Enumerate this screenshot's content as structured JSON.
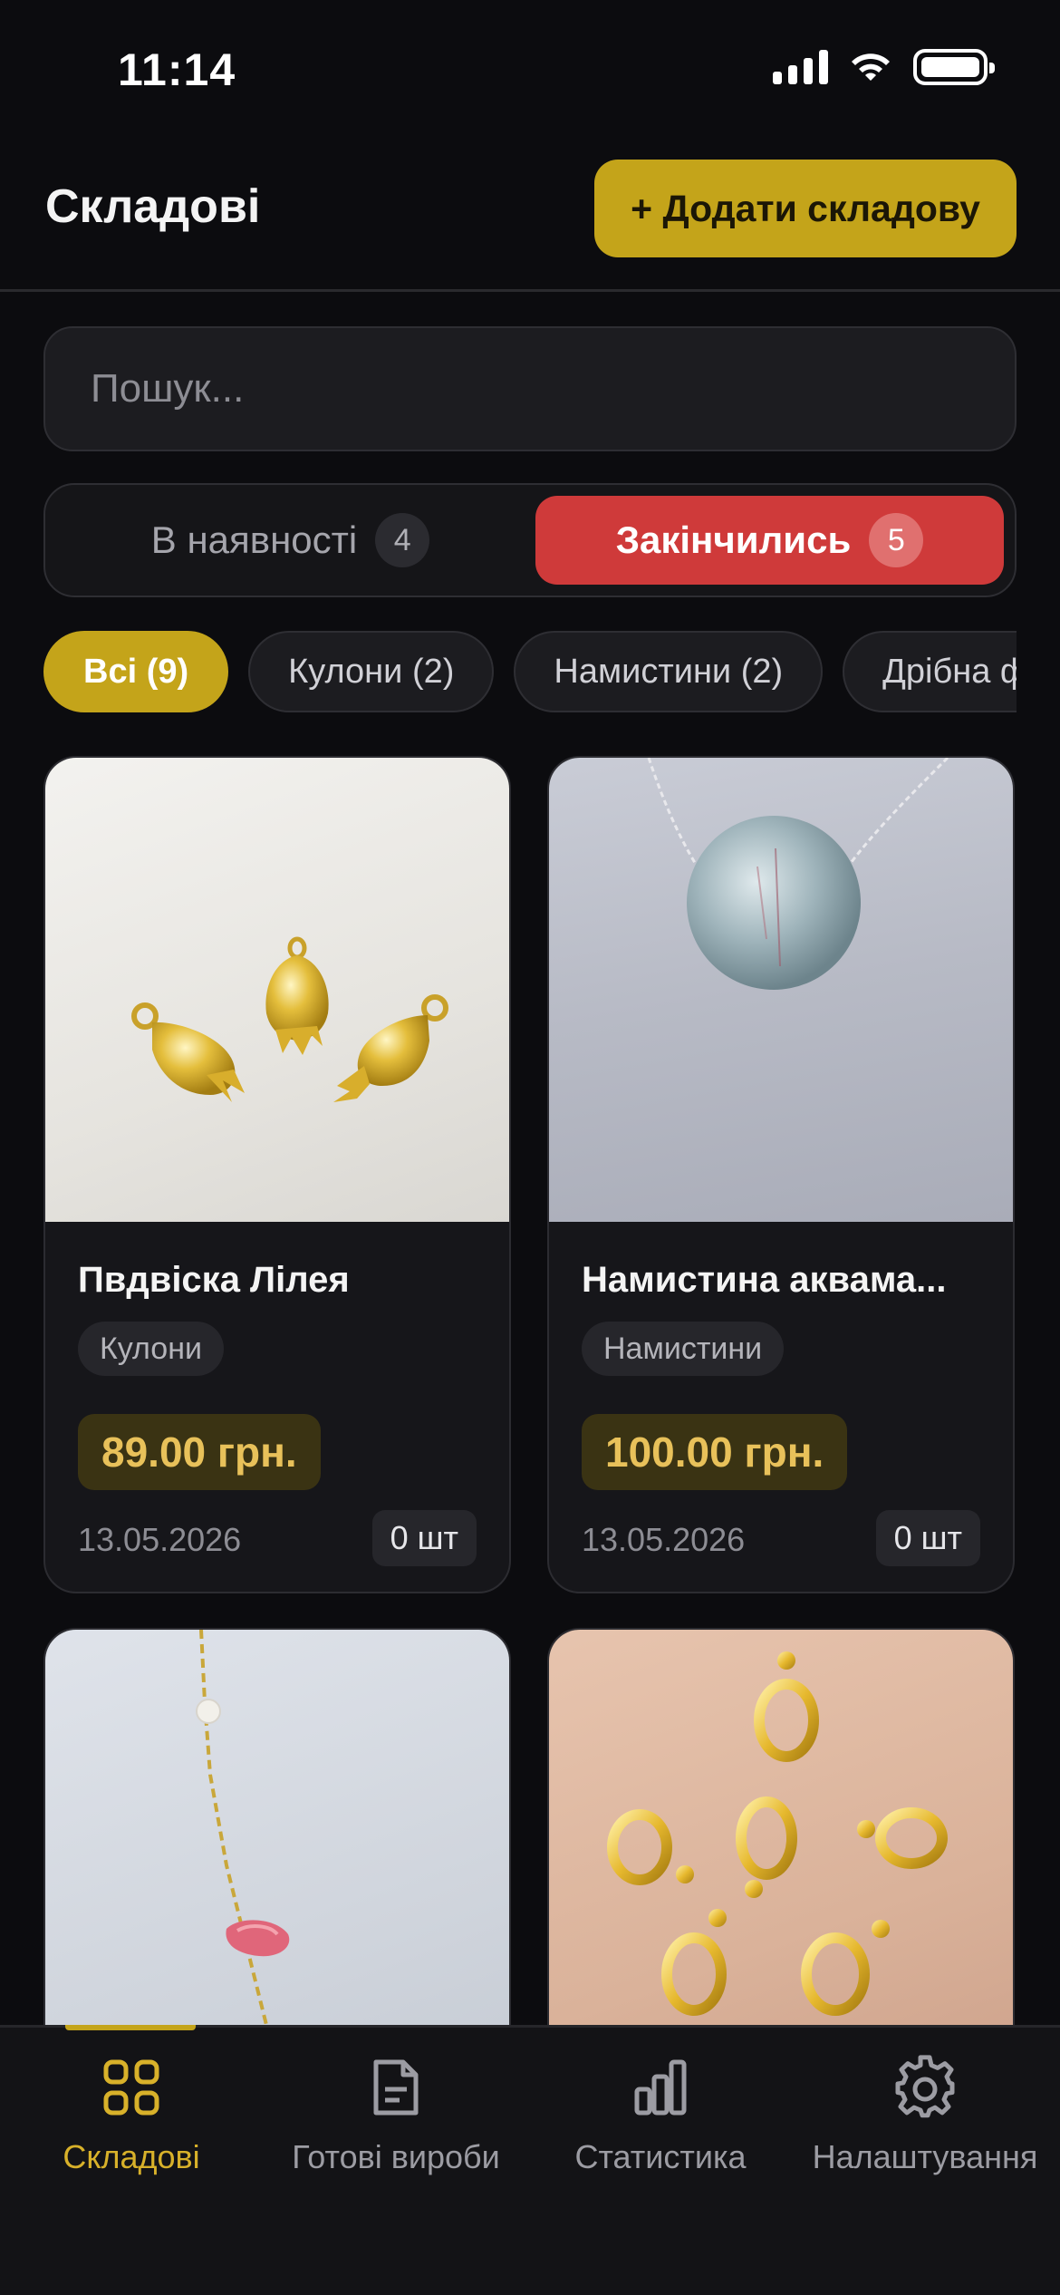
{
  "status_bar": {
    "time": "11:14"
  },
  "header": {
    "title": "Складові",
    "add_button": "+ Додати складову"
  },
  "search": {
    "placeholder": "Пошук..."
  },
  "segment": {
    "in_stock_label": "В наявності",
    "in_stock_count": "4",
    "out_label": "Закінчились",
    "out_count": "5",
    "active": "out"
  },
  "chips": [
    "Всі (9)",
    "Кулони (2)",
    "Намистини (2)",
    "Дрібна ф"
  ],
  "cards": [
    {
      "name": "Пвдвіска Лілея",
      "category": "Кулони",
      "price": "89.00 грн.",
      "date": "13.05.2026",
      "qty": "0 шт"
    },
    {
      "name": "Намистина аквама...",
      "category": "Намистини",
      "price": "100.00 грн.",
      "date": "13.05.2026",
      "qty": "0 шт"
    }
  ],
  "nav": {
    "items": [
      "Складові",
      "Готові вироби",
      "Статистика",
      "Налаштування"
    ],
    "active": "Складові"
  },
  "colors": {
    "accent": "#c4a41a",
    "danger": "#cf3a3a",
    "background": "#0c0c0f",
    "card": "#16161a"
  }
}
